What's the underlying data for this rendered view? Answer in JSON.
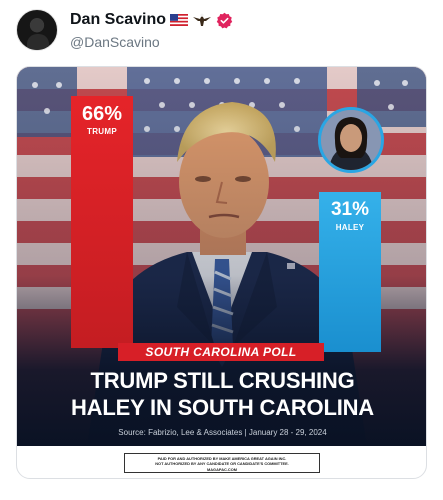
{
  "tweet": {
    "display_name": "Dan Scavino",
    "handle": "@DanScavino",
    "name_icons": [
      "us-flag-icon",
      "eagle-icon",
      "verified-badge-icon"
    ],
    "verified_color": "#e0245e"
  },
  "poster": {
    "trump": {
      "percent": "66%",
      "label": "TRUMP",
      "color": "#e52429"
    },
    "haley": {
      "percent": "31%",
      "label": "HALEY",
      "color": "#2aa6e4"
    },
    "badge": "SOUTH CAROLINA POLL",
    "headline_line1": "TRUMP STILL CRUSHING",
    "headline_line2": "HALEY IN SOUTH CAROLINA",
    "source": "Source: Fabrizio, Lee & Associates | January 28 - 29, 2024"
  },
  "disclaimer": {
    "line1": "PAID FOR AND AUTHORIZED BY MAKE AMERICA GREAT AGAIN INC.",
    "line2": "NOT AUTHORIZED BY ANY CANDIDATE OR CANDIDATE'S COMMITTEE.",
    "line3": "MAGAPAC.COM"
  }
}
